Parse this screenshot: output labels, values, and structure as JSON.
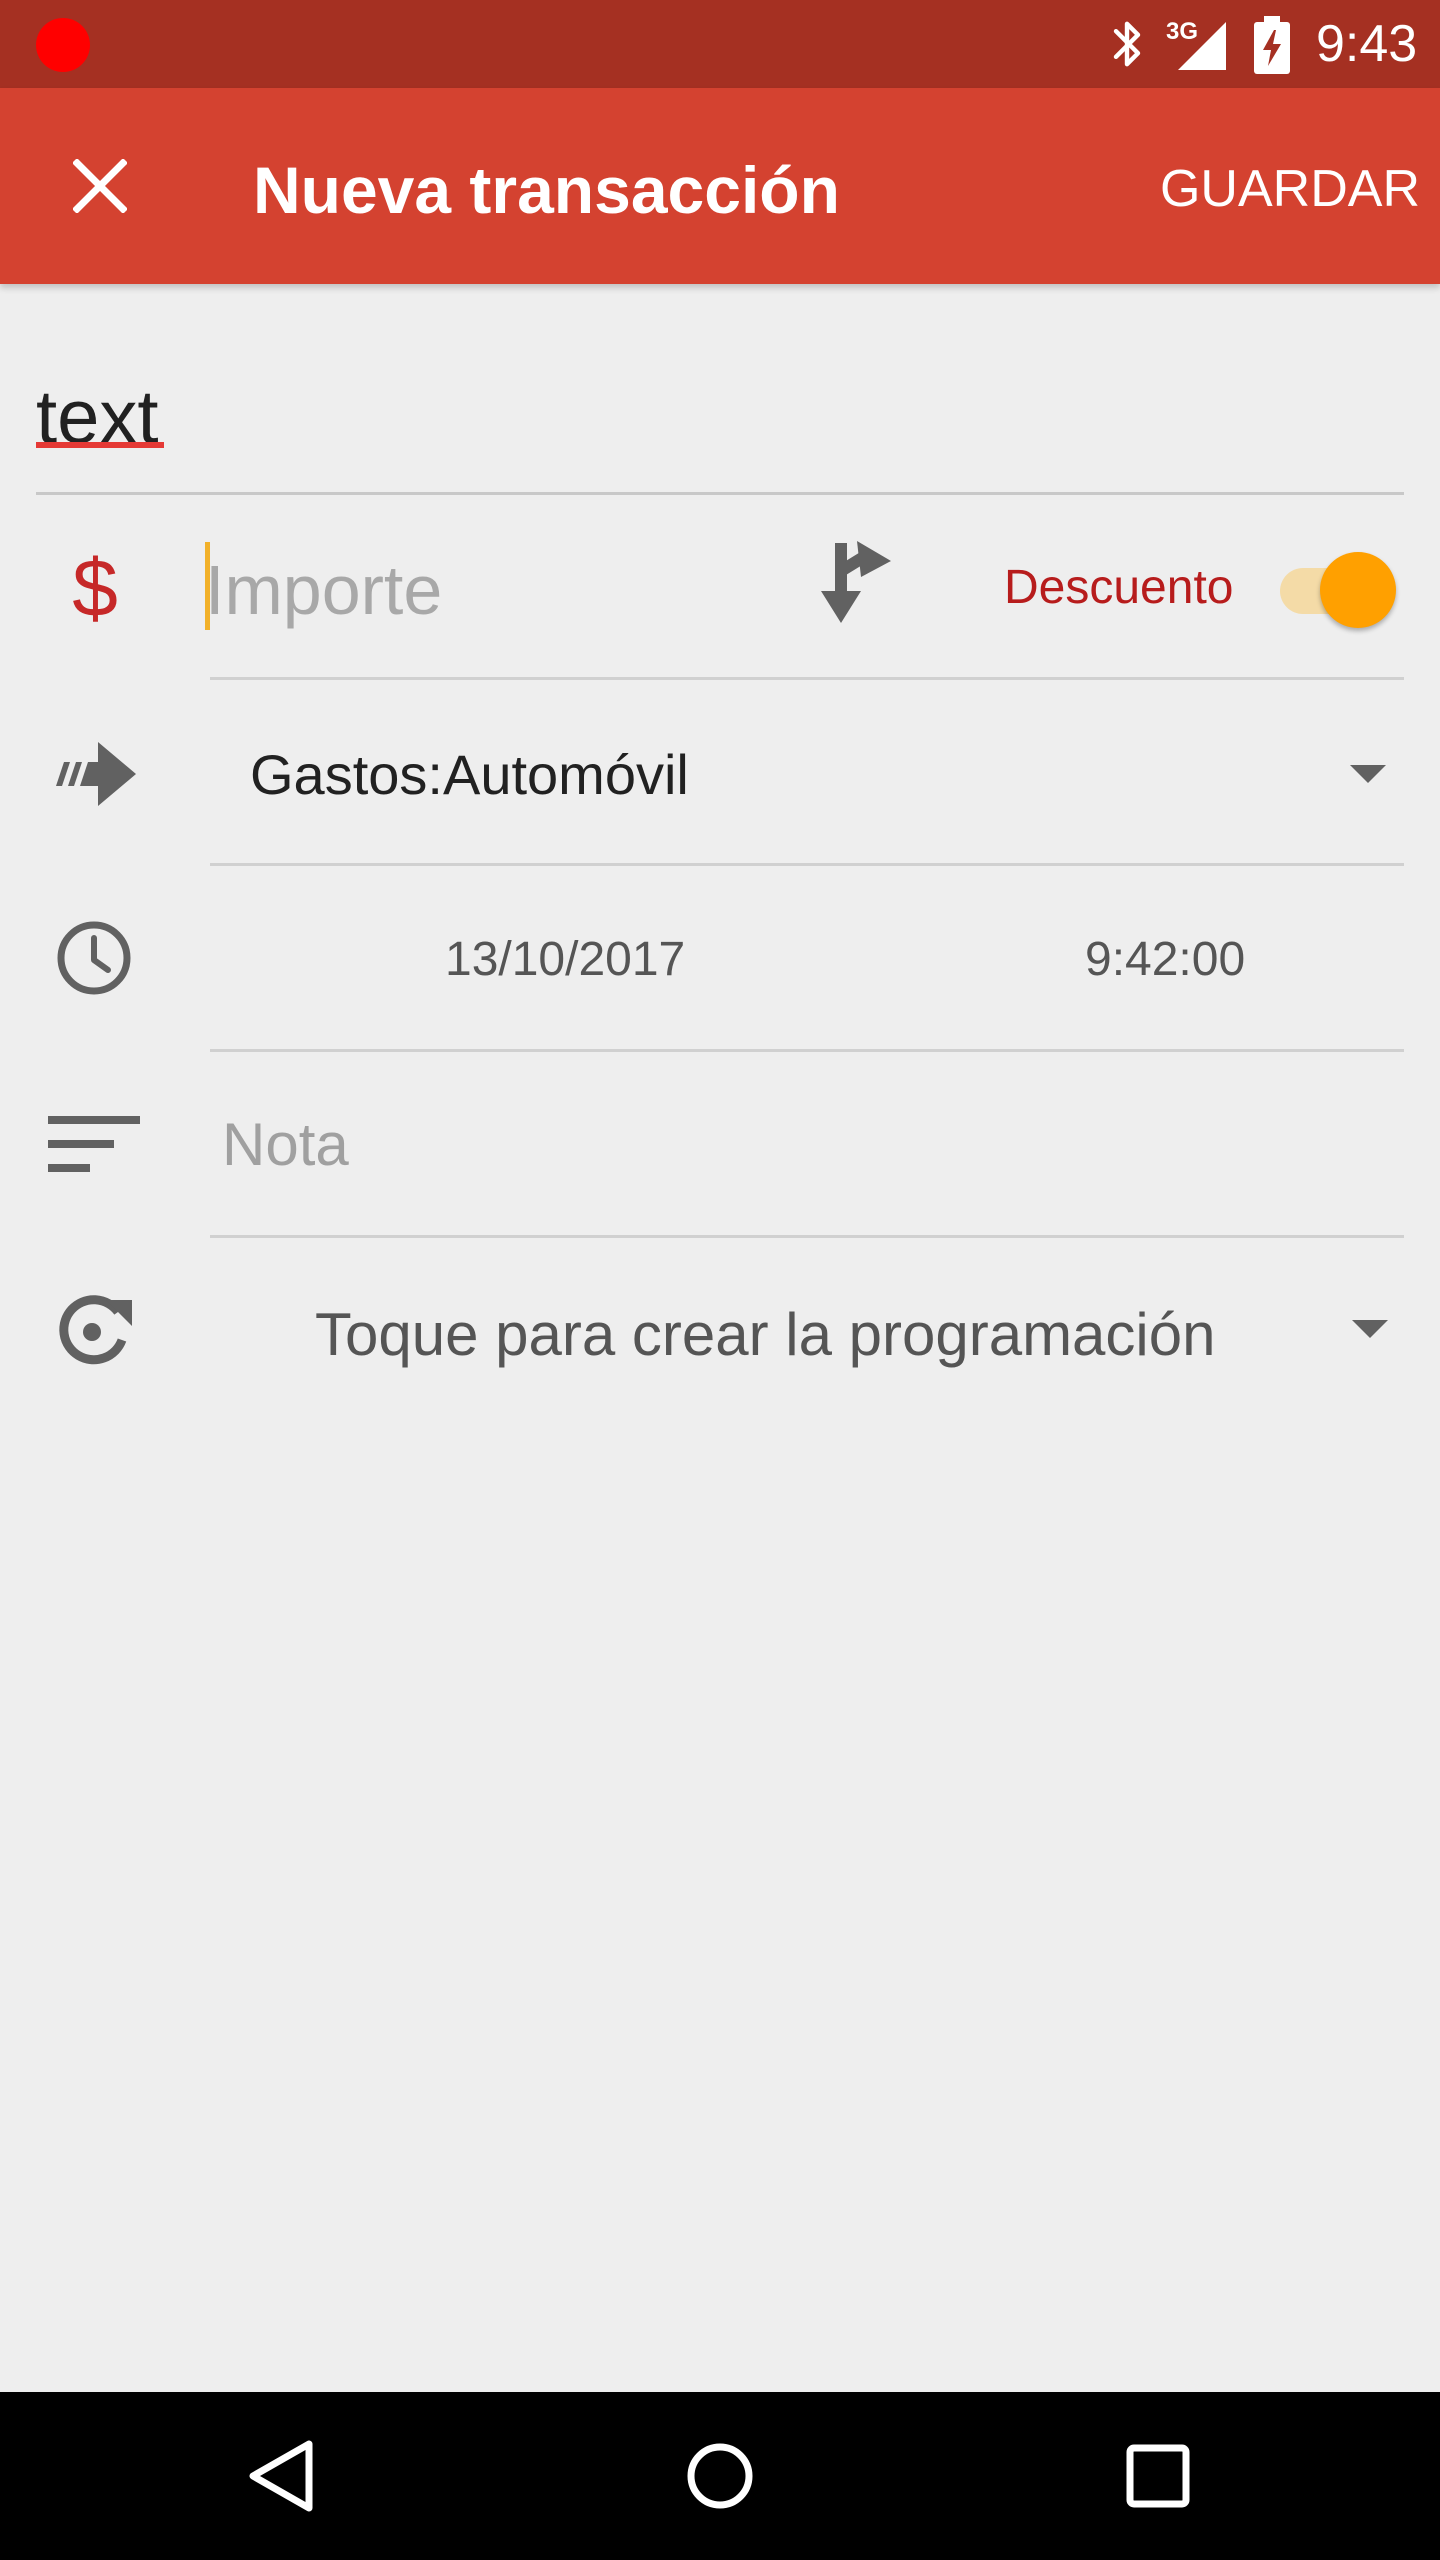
{
  "status_bar": {
    "time": "9:43",
    "network_label": "3G"
  },
  "toolbar": {
    "title": "Nueva transacción",
    "save_label": "GUARDAR"
  },
  "form": {
    "description_value": "text",
    "amount_placeholder": "Importe",
    "discount_label": "Descuento",
    "discount_enabled": true,
    "account_value": "Gastos:Automóvil",
    "date_value": "13/10/2017",
    "time_value": "9:42:00",
    "note_placeholder": "Nota",
    "schedule_label": "Toque para crear la programación"
  },
  "colors": {
    "status_bar": "#a53022",
    "toolbar": "#d44230",
    "accent": "#ffa000",
    "currency": "#c62828"
  },
  "icons": {
    "close": "close-icon",
    "currency": "dollar-icon",
    "split": "split-icon",
    "transfer": "transfer-arrow-icon",
    "clock": "clock-icon",
    "notes": "notes-icon",
    "recurrence": "recurrence-icon",
    "back": "back-icon",
    "home": "home-icon",
    "recents": "recents-icon"
  }
}
